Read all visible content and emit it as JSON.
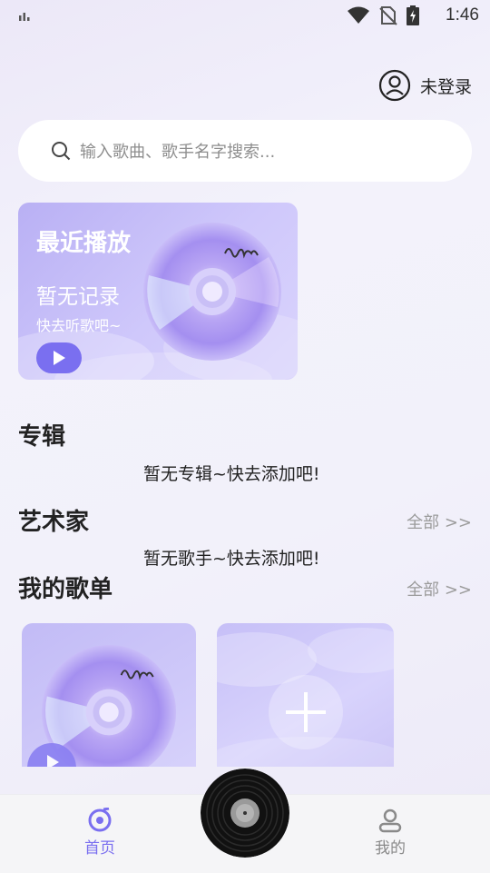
{
  "status_bar": {
    "time": "1:46"
  },
  "header": {
    "login_label": "未登录"
  },
  "search": {
    "placeholder": "输入歌曲、歌手名字搜索..."
  },
  "recent": {
    "title": "最近播放",
    "empty_text": "暂无记录",
    "hint": "快去听歌吧~"
  },
  "sections": {
    "albums": {
      "title": "专辑",
      "empty": "暂无专辑~快去添加吧!"
    },
    "artists": {
      "title": "艺术家",
      "empty": "暂无歌手~快去添加吧!",
      "all": "全部 >>"
    },
    "playlists": {
      "title": "我的歌单",
      "all": "全部 >>"
    }
  },
  "tabbar": {
    "home": "首页",
    "mine": "我的",
    "active_color": "#7a6ff0",
    "inactive_color": "#8a8a8a"
  },
  "colors": {
    "accent": "#7a6ff0"
  }
}
